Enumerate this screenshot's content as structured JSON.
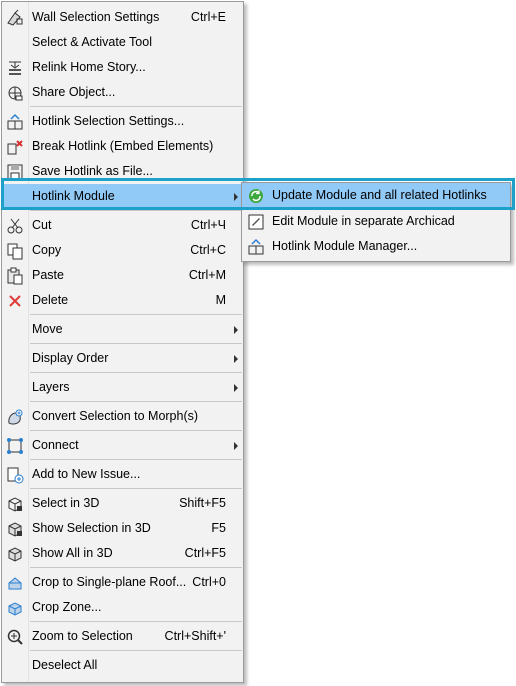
{
  "menu": {
    "items": [
      {
        "label": "Wall Selection Settings",
        "shortcut": "Ctrl+E",
        "icon": "wall-settings-icon"
      },
      {
        "label": "Select & Activate Tool",
        "shortcut": "",
        "icon": ""
      },
      {
        "label": "Relink Home Story...",
        "shortcut": "",
        "icon": "relink-story-icon"
      },
      {
        "label": "Share Object...",
        "shortcut": "",
        "icon": "share-object-icon"
      },
      {
        "label": "Hotlink Selection Settings...",
        "shortcut": "",
        "icon": "hotlink-settings-icon"
      },
      {
        "label": "Break Hotlink (Embed Elements)",
        "shortcut": "",
        "icon": "break-hotlink-icon"
      },
      {
        "label": "Save Hotlink as File...",
        "shortcut": "",
        "icon": "save-hotlink-icon"
      },
      {
        "label": "Hotlink Module",
        "shortcut": "",
        "icon": ""
      },
      {
        "label": "Cut",
        "shortcut": "Ctrl+Ч",
        "icon": "scissors-icon"
      },
      {
        "label": "Copy",
        "shortcut": "Ctrl+C",
        "icon": "copy-icon"
      },
      {
        "label": "Paste",
        "shortcut": "Ctrl+M",
        "icon": "paste-icon"
      },
      {
        "label": "Delete",
        "shortcut": "M",
        "icon": "delete-x-icon"
      },
      {
        "label": "Move",
        "shortcut": "",
        "icon": ""
      },
      {
        "label": "Display Order",
        "shortcut": "",
        "icon": ""
      },
      {
        "label": "Layers",
        "shortcut": "",
        "icon": ""
      },
      {
        "label": "Convert Selection to Morph(s)",
        "shortcut": "",
        "icon": "morph-icon"
      },
      {
        "label": "Connect",
        "shortcut": "",
        "icon": "connect-icon"
      },
      {
        "label": "Add to New Issue...",
        "shortcut": "",
        "icon": "new-issue-icon"
      },
      {
        "label": "Select in 3D",
        "shortcut": "Shift+F5",
        "icon": "select-3d-icon"
      },
      {
        "label": "Show Selection in 3D",
        "shortcut": "F5",
        "icon": "show-selection-3d-icon"
      },
      {
        "label": "Show All in 3D",
        "shortcut": "Ctrl+F5",
        "icon": "show-all-3d-icon"
      },
      {
        "label": "Crop to Single-plane Roof...",
        "shortcut": "Ctrl+0",
        "icon": "crop-roof-icon"
      },
      {
        "label": "Crop Zone...",
        "shortcut": "",
        "icon": "crop-zone-icon"
      },
      {
        "label": "Zoom to Selection",
        "shortcut": "Ctrl+Shift+'",
        "icon": "zoom-selection-icon"
      },
      {
        "label": "Deselect All",
        "shortcut": "",
        "icon": ""
      }
    ]
  },
  "submenu": {
    "items": [
      {
        "label": "Update Module and all related Hotlinks",
        "icon": "update-module-icon"
      },
      {
        "label": "Edit Module in separate Archicad",
        "icon": "edit-module-icon"
      },
      {
        "label": "Hotlink Module Manager...",
        "icon": "module-manager-icon"
      }
    ]
  },
  "colors": {
    "highlight": "#91c9f7",
    "frame": "#1ea1c8",
    "menu_bg": "#f2f2f2"
  }
}
